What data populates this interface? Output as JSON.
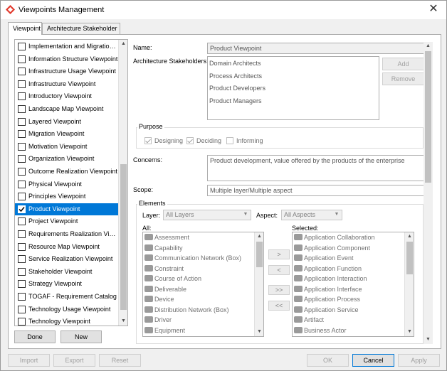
{
  "window": {
    "title": "Viewpoints Management",
    "close_glyph": "✕"
  },
  "tabs": [
    {
      "label": "Viewpoint"
    },
    {
      "label": "Architecture Stakeholder"
    }
  ],
  "viewpoints": [
    {
      "label": "Implementation and Migration ...",
      "checked": false
    },
    {
      "label": "Information Structure Viewpoint",
      "checked": false
    },
    {
      "label": "Infrastructure Usage Viewpoint",
      "checked": false
    },
    {
      "label": "Infrastructure Viewpoint",
      "checked": false
    },
    {
      "label": "Introductory Viewpoint",
      "checked": false
    },
    {
      "label": "Landscape Map Viewpoint",
      "checked": false
    },
    {
      "label": "Layered Viewpoint",
      "checked": false
    },
    {
      "label": "Migration Viewpoint",
      "checked": false
    },
    {
      "label": "Motivation Viewpoint",
      "checked": false
    },
    {
      "label": "Organization Viewpoint",
      "checked": false
    },
    {
      "label": "Outcome Realization Viewpoint",
      "checked": false
    },
    {
      "label": "Physical Viewpoint",
      "checked": false
    },
    {
      "label": "Principles Viewpoint",
      "checked": false
    },
    {
      "label": "Product Viewpoint",
      "checked": true,
      "selected": true
    },
    {
      "label": "Project Viewpoint",
      "checked": false
    },
    {
      "label": "Requirements Realization View...",
      "checked": false
    },
    {
      "label": "Resource Map Viewpoint",
      "checked": false
    },
    {
      "label": "Service Realization Viewpoint",
      "checked": false
    },
    {
      "label": "Stakeholder Viewpoint",
      "checked": false
    },
    {
      "label": "Strategy Viewpoint",
      "checked": false
    },
    {
      "label": "TOGAF - Requirement Catalog",
      "checked": false
    },
    {
      "label": "Technology Usage Viewpoint",
      "checked": false
    },
    {
      "label": "Technology Viewpoint",
      "checked": false
    }
  ],
  "list_buttons": {
    "done": "Done",
    "new": "New"
  },
  "details": {
    "name_label": "Name:",
    "name_value": "Product Viewpoint",
    "stakeholders_label": "Architecture Stakeholders:",
    "stakeholders": [
      "Domain Architects",
      "Process Architects",
      "Product Developers",
      "Product Managers"
    ],
    "add_label": "Add",
    "remove_label": "Remove",
    "purpose_label": "Purpose",
    "purpose_options": [
      {
        "label": "Designing",
        "checked": true
      },
      {
        "label": "Deciding",
        "checked": true
      },
      {
        "label": "Informing",
        "checked": false
      }
    ],
    "concerns_label": "Concerns:",
    "concerns_value": "Product development, value offered by the products of the enterprise",
    "scope_label": "Scope:",
    "scope_value": "Multiple layer/Multiple aspect",
    "elements_label": "Elements",
    "layer_label": "Layer:",
    "layer_value": "All Layers",
    "aspect_label": "Aspect:",
    "aspect_value": "All Aspects",
    "all_label": "All:",
    "selected_label": "Selected:",
    "all_elements": [
      "Assessment",
      "Capability",
      "Communication Network (Box)",
      "Constraint",
      "Course of Action",
      "Deliverable",
      "Device",
      "Distribution Network (Box)",
      "Driver",
      "Equipment"
    ],
    "selected_elements": [
      "Application Collaboration",
      "Application Component",
      "Application Event",
      "Application Function",
      "Application Interaction",
      "Application Interface",
      "Application Process",
      "Application Service",
      "Artifact",
      "Business Actor"
    ],
    "move_buttons": [
      ">",
      "<",
      ">>",
      "<<"
    ]
  },
  "footer": {
    "import": "Import",
    "export": "Export",
    "reset": "Reset",
    "ok": "OK",
    "cancel": "Cancel",
    "apply": "Apply"
  }
}
